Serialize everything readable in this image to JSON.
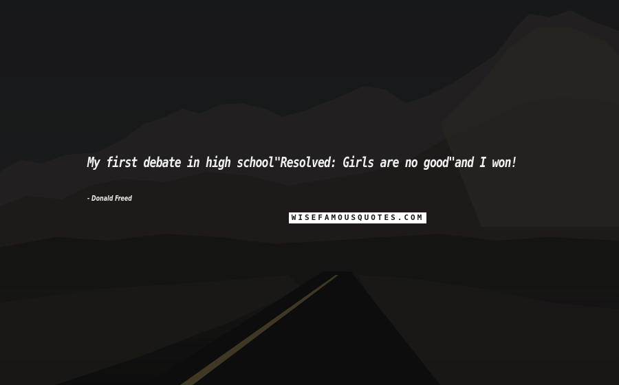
{
  "quote": {
    "text": "My first debate in high school\"Resolved: Girls are no good\"and I won!",
    "author": "- Donald Freed"
  },
  "watermark": {
    "text": "WISEFAMOUSQUOTES.COM"
  },
  "background": {
    "description_icon": "mountain-road-landscape-icon",
    "sky_color": "#2a2b2d",
    "rock_color": "#3a3532",
    "road_color": "#161616",
    "line_color": "#8a7a4a"
  }
}
